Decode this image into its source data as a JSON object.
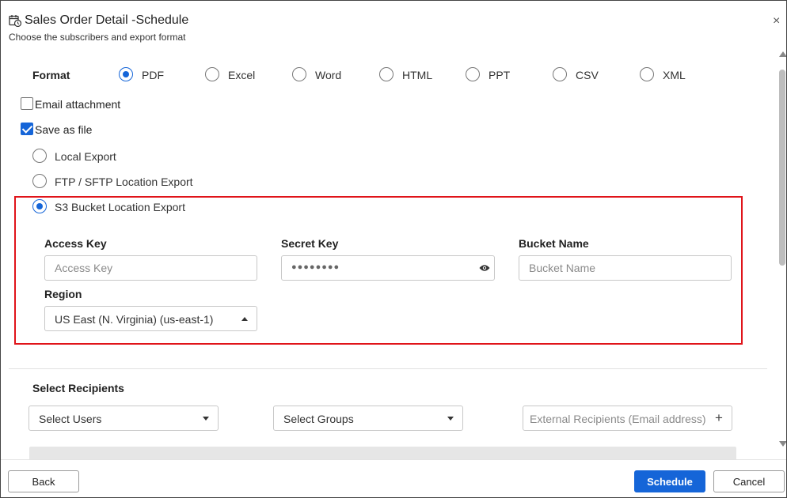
{
  "header": {
    "title": "Sales Order Detail -Schedule",
    "subtitle": "Choose the subscribers and export format",
    "close_glyph": "×",
    "icon": "calendar-clock-icon"
  },
  "format": {
    "label": "Format",
    "options": [
      "PDF",
      "Excel",
      "Word",
      "HTML",
      "PPT",
      "CSV",
      "XML"
    ],
    "selected": "PDF"
  },
  "email_attachment": {
    "label": "Email attachment",
    "checked": false
  },
  "save_as_file": {
    "label": "Save as file",
    "checked": true
  },
  "export_options": {
    "items": [
      "Local Export",
      "FTP / SFTP Location Export",
      "S3 Bucket Location Export"
    ],
    "selected": "S3 Bucket Location Export"
  },
  "s3": {
    "access_key": {
      "label": "Access Key",
      "placeholder": "Access Key",
      "value": ""
    },
    "secret_key": {
      "label": "Secret Key",
      "masked_value": "●●●●●●●●",
      "icon": "eye-icon"
    },
    "bucket_name": {
      "label": "Bucket Name",
      "placeholder": "Bucket Name",
      "value": ""
    },
    "region": {
      "label": "Region",
      "value": "US East (N. Virginia) (us-east-1)"
    },
    "highlight_color": "#e0141a"
  },
  "recipients": {
    "label": "Select Recipients",
    "users_placeholder": "Select Users",
    "groups_placeholder": "Select Groups",
    "external_placeholder": "External Recipients (Email address)",
    "add_glyph": "+"
  },
  "footer": {
    "back_label": "Back",
    "schedule_label": "Schedule",
    "cancel_label": "Cancel"
  },
  "colors": {
    "accent": "#1565d8"
  }
}
